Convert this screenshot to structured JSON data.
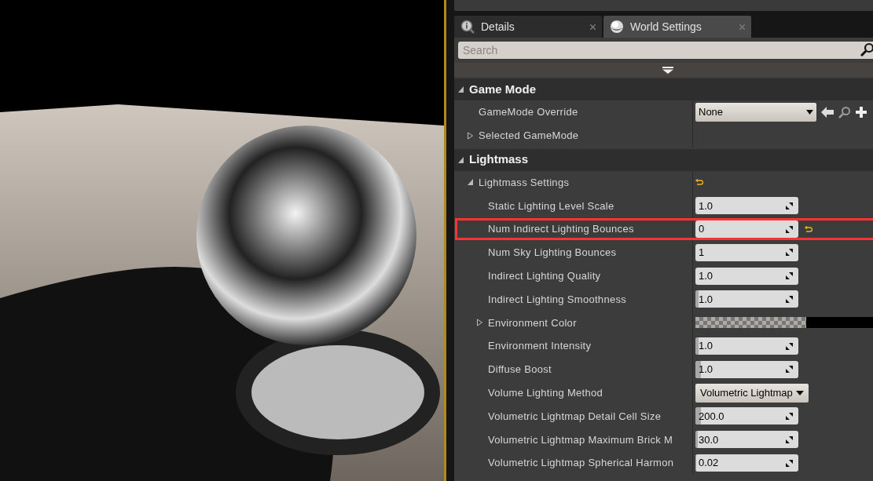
{
  "tabs": [
    {
      "label": "Details",
      "selected": false,
      "kind": "details"
    },
    {
      "label": "World Settings",
      "selected": true,
      "kind": "world"
    }
  ],
  "search": {
    "placeholder": "Search"
  },
  "categories": [
    {
      "title": "Game Mode",
      "expanded": true,
      "rows": [
        {
          "kind": "class",
          "label": "GameMode Override",
          "value": "None"
        },
        {
          "kind": "group",
          "label": "Selected GameMode",
          "expanded": false
        }
      ]
    },
    {
      "title": "Lightmass",
      "expanded": true,
      "rows": [
        {
          "kind": "group",
          "label": "Lightmass Settings",
          "expanded": true,
          "reset": true,
          "children": [
            {
              "kind": "number",
              "label": "Static Lighting Level Scale",
              "value": "1.0"
            },
            {
              "kind": "number",
              "label": "Num Indirect Lighting Bounces",
              "value": "0",
              "reset": true,
              "highlighted": true
            },
            {
              "kind": "number",
              "label": "Num Sky Lighting Bounces",
              "value": "1"
            },
            {
              "kind": "number",
              "label": "Indirect Lighting Quality",
              "value": "1.0"
            },
            {
              "kind": "number",
              "label": "Indirect Lighting Smoothness",
              "value": "1.0",
              "level": 0.03
            },
            {
              "kind": "color",
              "label": "Environment Color",
              "expanded": false
            },
            {
              "kind": "number",
              "label": "Environment Intensity",
              "value": "1.0",
              "level": 0.03
            },
            {
              "kind": "number",
              "label": "Diffuse Boost",
              "value": "1.0",
              "level": 0.05
            },
            {
              "kind": "enum",
              "label": "Volume Lighting Method",
              "value": "Volumetric Lightmap"
            },
            {
              "kind": "number",
              "label": "Volumetric Lightmap Detail Cell Size",
              "value": "200.0",
              "level": 0.05
            },
            {
              "kind": "number",
              "label": "Volumetric Lightmap Maximum Brick M",
              "value": "30.0",
              "level": 0.02
            },
            {
              "kind": "number",
              "label": "Volumetric Lightmap Spherical Harmon",
              "value": "0.02",
              "level": 0.01
            }
          ]
        }
      ]
    }
  ]
}
